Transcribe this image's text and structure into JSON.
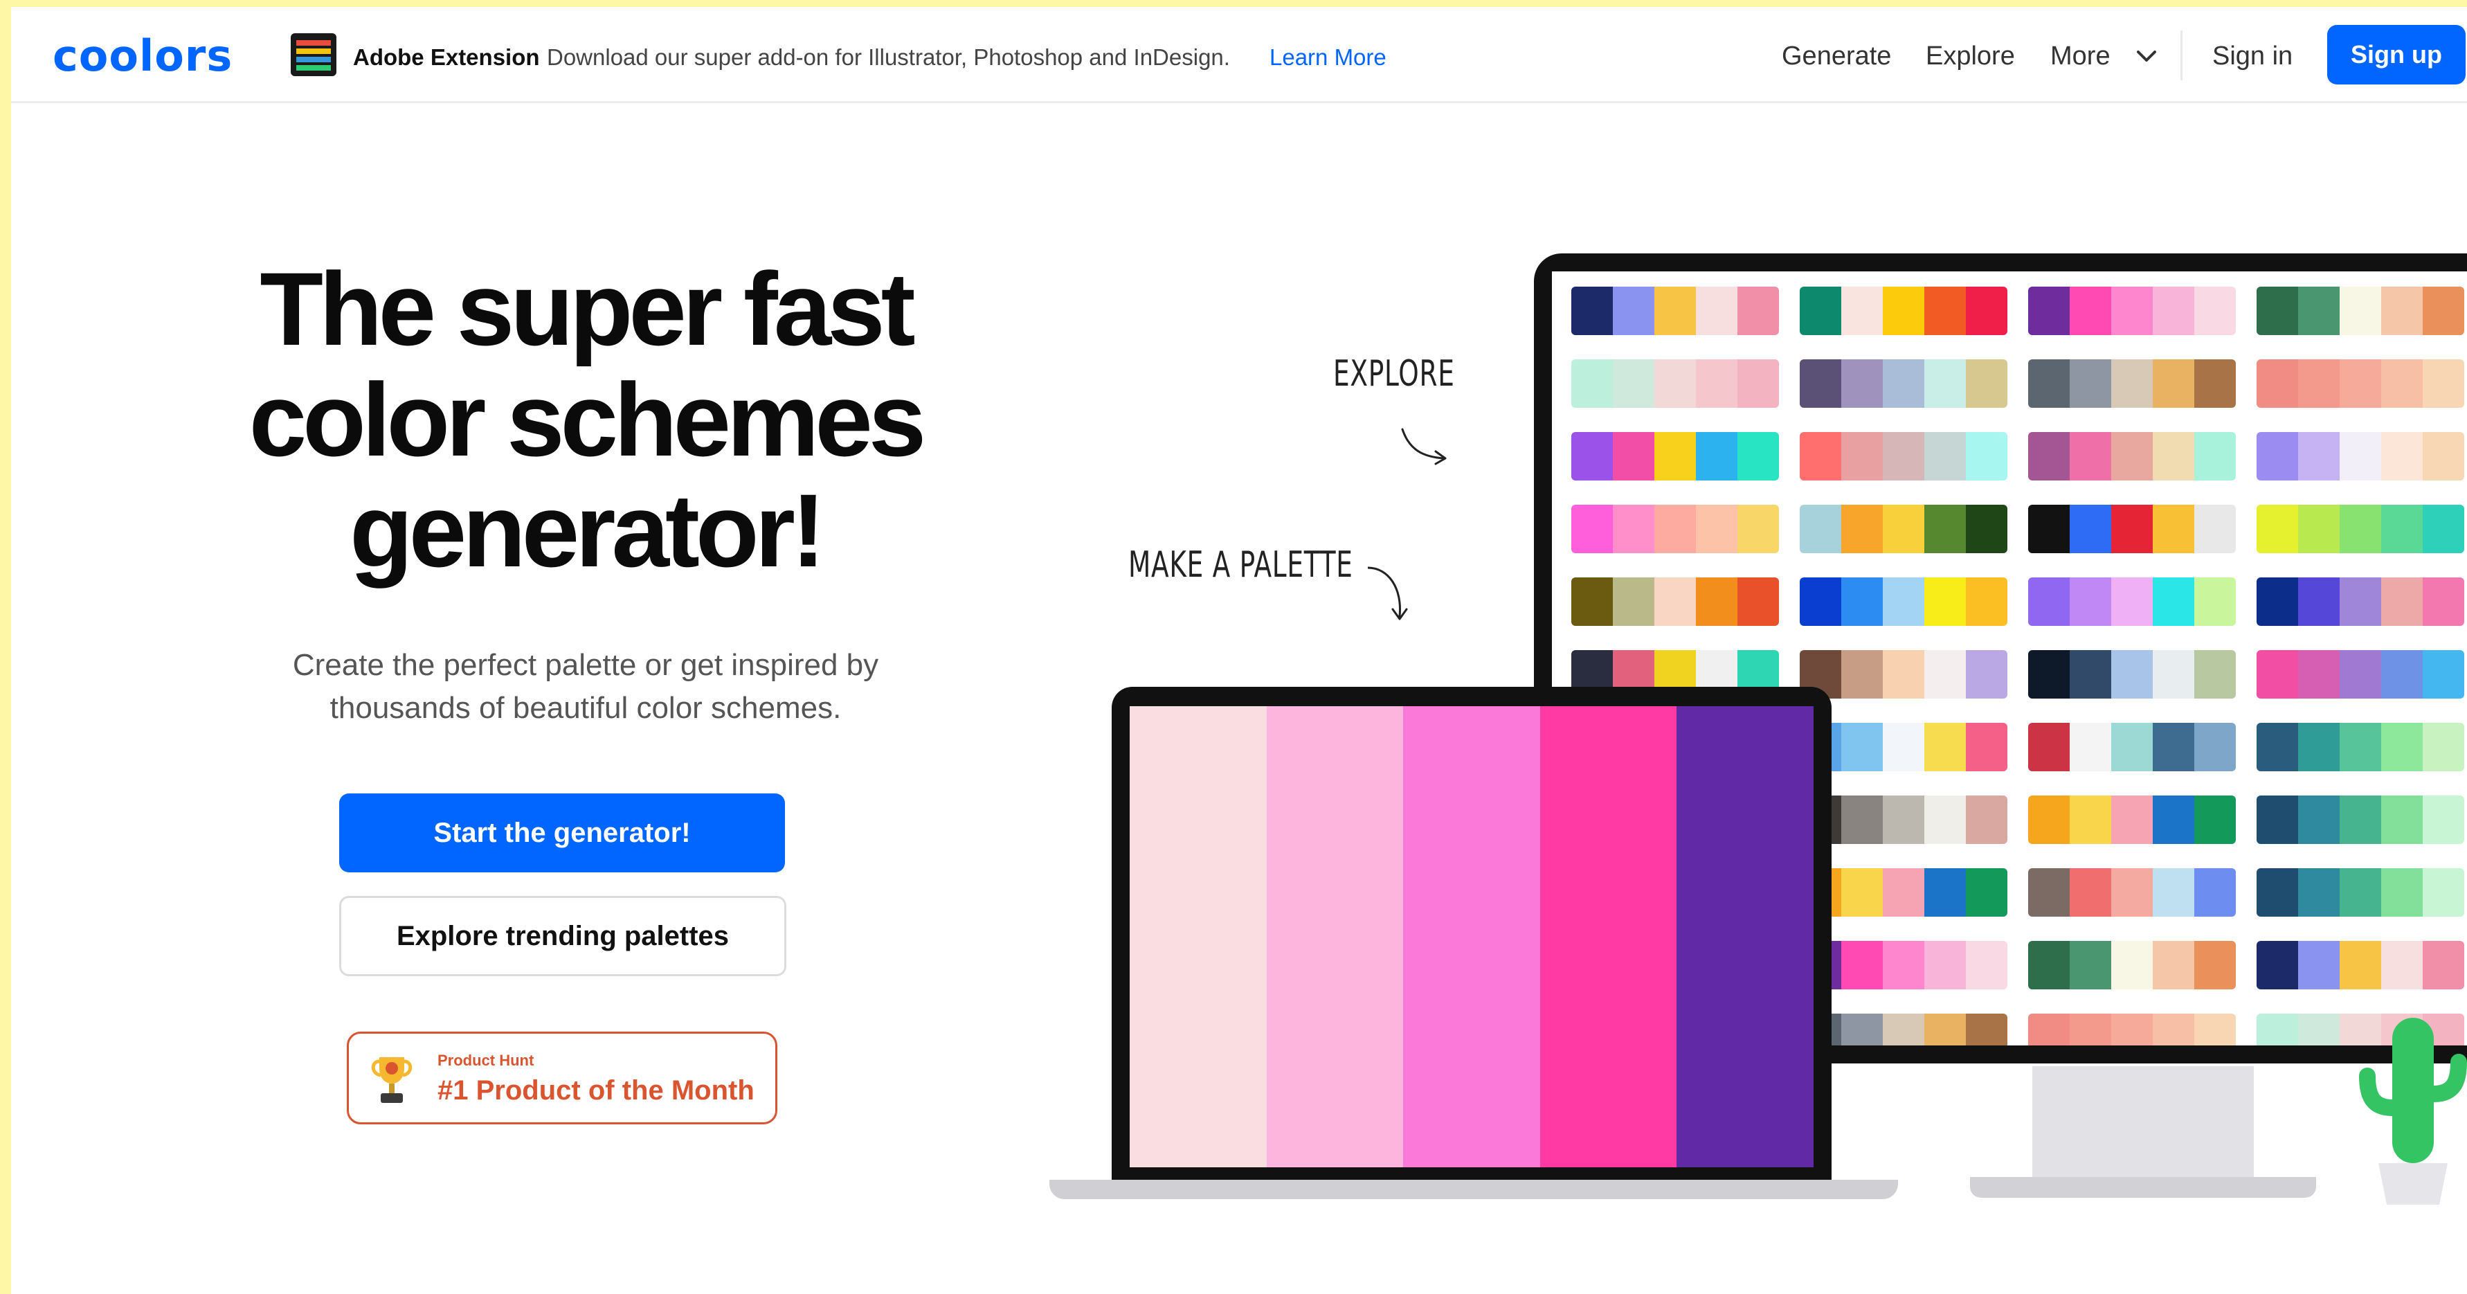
{
  "nav": {
    "logo": "coolors",
    "extension_title": "Adobe Extension",
    "extension_desc": "Download our super add-on for Illustrator, Photoshop and InDesign.",
    "extension_link": "Learn More",
    "links": [
      "Generate",
      "Explore",
      "More"
    ],
    "signin": "Sign in",
    "signup": "Sign up"
  },
  "hero": {
    "title_lines": [
      "The super fast",
      "color schemes",
      "generator!"
    ],
    "subtitle_lines": [
      "Create the perfect palette or get inspired by",
      "thousands of beautiful color schemes."
    ],
    "start_button": "Start the generator!",
    "explore_button": "Explore trending palettes",
    "badge_small": "Product Hunt",
    "badge_big": "#1 Product of the Month"
  },
  "illustration": {
    "explore_label": "EXPLORE",
    "make_label": "MAKE A PALETTE",
    "laptop_palette": [
      "#f9dde0",
      "#fdb5de",
      "#fb79d8",
      "#ff3aa5",
      "#6229a6"
    ],
    "monitor_palettes": [
      [
        [
          "#1d2a6a",
          "#8a93f0",
          "#f8c445",
          "#f7dfe0",
          "#f18fa9"
        ],
        [
          "#0d8a6e",
          "#f9e4df",
          "#fccb0c",
          "#f25c24",
          "#ef1f4a"
        ],
        [
          "#6e2c9c",
          "#ff4ab3",
          "#fd86cf",
          "#f9b4d9",
          "#f9d9e4"
        ],
        [
          "#2f6e4a",
          "#4a9670",
          "#f8f6e4",
          "#f6c6a9",
          "#e9905b"
        ]
      ],
      [
        [
          "#bcefdc",
          "#cfe9dc",
          "#f2d8d6",
          "#f5c7cc",
          "#f4b3c0"
        ],
        [
          "#5b5177",
          "#9f93bd",
          "#a9bcd8",
          "#c9eee8",
          "#d7c890"
        ],
        [
          "#5c6670",
          "#8e96a4",
          "#d8c8b6",
          "#e8b262",
          "#a87447"
        ],
        [
          "#f08c84",
          "#f49a8d",
          "#f6ab9a",
          "#f7bfa6",
          "#f8d6b4"
        ]
      ],
      [
        [
          "#9b52e8",
          "#f24ea8",
          "#f7d11c",
          "#2bb2ef",
          "#29e4c2"
        ],
        [
          "#ff6f6e",
          "#e8a1a0",
          "#d7b6b8",
          "#c6d6d4",
          "#a8f6f0"
        ],
        [
          "#a35594",
          "#ef70a8",
          "#e8a8a0",
          "#f0dcb0",
          "#a8f2dc"
        ],
        [
          "#9b8cf2",
          "#c6b3f4",
          "#f2eff8",
          "#fbe6d8",
          "#f8d8b4"
        ]
      ],
      [
        [
          "#ff5fda",
          "#ff8fcb",
          "#fdaaa0",
          "#fdc3a8",
          "#f8d768"
        ],
        [
          "#a7d2dc",
          "#f7a52b",
          "#f8d03c",
          "#55882f",
          "#1e4617"
        ],
        [
          "#121212",
          "#2e6cf6",
          "#e52436",
          "#f8c034",
          "#e8e8e8"
        ],
        [
          "#e5f02f",
          "#b8ea50",
          "#88e270",
          "#5ad895",
          "#2fd0ba"
        ]
      ],
      [
        [
          "#6b5b10",
          "#b9b98a",
          "#f9d6c4",
          "#f28f1c",
          "#e8512a"
        ],
        [
          "#0a3ed1",
          "#2d8cf2",
          "#a4d4f4",
          "#f8ec19",
          "#fbbf24"
        ],
        [
          "#8f67f0",
          "#c088f5",
          "#f0b0f5",
          "#2ae6e6",
          "#c9f59c"
        ],
        [
          "#0c2d8a",
          "#5547d8",
          "#9f86d8",
          "#eda8a8",
          "#f478b0"
        ]
      ],
      [
        [
          "#2a2d3f",
          "#e2617c",
          "#f0d320",
          "#f0f0f0",
          "#2fd6b4"
        ],
        [
          "#6f4a3a",
          "#c89d86",
          "#f8d2b0",
          "#f5eeee",
          "#b9a8e4"
        ],
        [
          "#0e1a2a",
          "#324a6a",
          "#a8c4e8",
          "#e8eef0",
          "#b8c8a0"
        ],
        [
          "#f24ea3",
          "#d65eb3",
          "#a07ad2",
          "#6e92e6",
          "#44b6f0"
        ]
      ],
      [
        [
          "#1f6f7a",
          "#4aa2b0",
          "#8cc4c8",
          "#eaeaea",
          "#f8a02b"
        ],
        [
          "#5aa4e8",
          "#80c4f0",
          "#f2f6fa",
          "#f8dc50",
          "#f46087"
        ],
        [
          "#cc3344",
          "#f4f4f4",
          "#9cd8d4",
          "#3e6c90",
          "#7ea6c8"
        ],
        [
          "#2a5c7e",
          "#2f9c98",
          "#58c49a",
          "#8ee89c",
          "#c8f2c0"
        ]
      ],
      [
        [
          "#0f3b2e",
          "#1c6b48",
          "#d67ba0",
          "#f2b8c4",
          "#fcd028"
        ],
        [
          "#403a36",
          "#8a8480",
          "#bcb8b0",
          "#f0eee8",
          "#d9a8a0"
        ],
        [
          "#f6a61c",
          "#f8d54a",
          "#f6a3b3",
          "#1b74c8",
          "#139a5a"
        ],
        [
          "#1e4d70",
          "#2f8aa0",
          "#46b48e",
          "#82e09a",
          "#c8f6d4"
        ]
      ],
      [
        [
          "#1a1a1a",
          "#ee1c25",
          "#f68a1e",
          "#fbbf1e",
          "#faeab8"
        ],
        [
          "#f6a61c",
          "#f8d54a",
          "#f6a3b3",
          "#1b74c8",
          "#139a5a"
        ],
        [
          "#7c6a64",
          "#f06e6e",
          "#f4aaa0",
          "#bfe0f0",
          "#6d8ef0"
        ],
        [
          "#1e4d70",
          "#2f8aa0",
          "#46b48e",
          "#82e09a",
          "#c8f6d4"
        ]
      ],
      [
        [
          "#0d8a6e",
          "#f9e4df",
          "#fccb0c",
          "#f25c24",
          "#ef1f4a"
        ],
        [
          "#6e2c9c",
          "#ff4ab3",
          "#fd86cf",
          "#f9b4d9",
          "#f9d9e4"
        ],
        [
          "#2f6e4a",
          "#4a9670",
          "#f8f6e4",
          "#f6c6a9",
          "#e9905b"
        ],
        [
          "#1d2a6a",
          "#8a93f0",
          "#f8c445",
          "#f7dfe0",
          "#f18fa9"
        ]
      ],
      [
        [
          "#5b5177",
          "#9f93bd",
          "#a9bcd8",
          "#c9eee8",
          "#d7c890"
        ],
        [
          "#5c6670",
          "#8e96a4",
          "#d8c8b6",
          "#e8b262",
          "#a87447"
        ],
        [
          "#f08c84",
          "#f49a8d",
          "#f6ab9a",
          "#f7bfa6",
          "#f8d6b4"
        ],
        [
          "#bcefdc",
          "#cfe9dc",
          "#f2d8d6",
          "#f5c7cc",
          "#f4b3c0"
        ]
      ]
    ]
  },
  "colors": {
    "accent": "#0066ff",
    "product_hunt": "#da552f"
  }
}
